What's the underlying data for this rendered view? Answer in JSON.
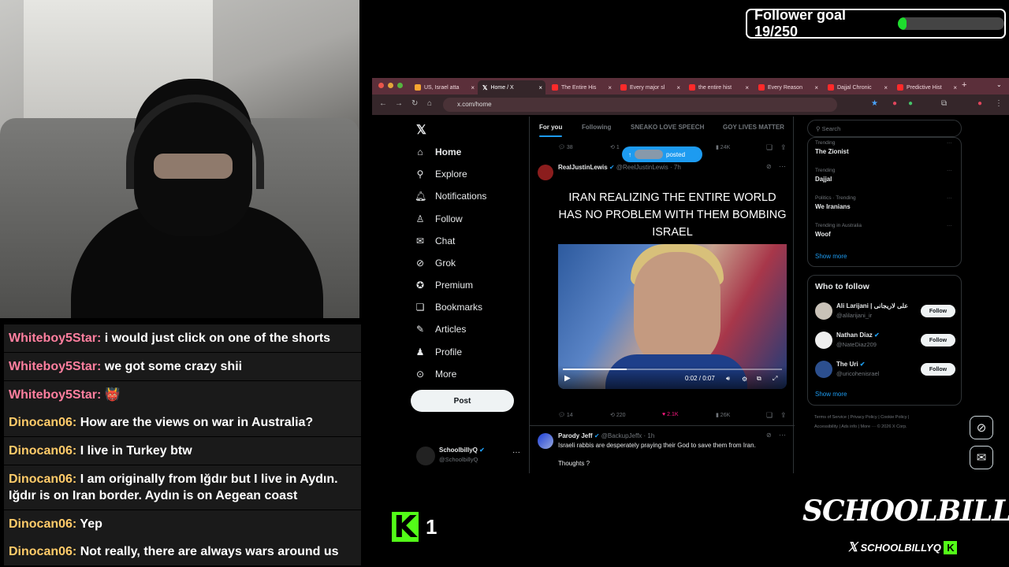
{
  "overlay": {
    "follower_goal": {
      "label": "Follower goal 19/250",
      "current": 19,
      "target": 250,
      "fill_fraction": 0.076,
      "color": "#1edc2e"
    },
    "kick_viewers": "1",
    "brand_name": "SCHOOLBILLYQ",
    "brand_handle": "SCHOOLBILLYQ"
  },
  "chat": [
    {
      "user": "Whiteboy5Star:",
      "message": "i would just click on one of the shorts",
      "color": "pink"
    },
    {
      "user": "Whiteboy5Star:",
      "message": "we got some crazy shii",
      "color": "pink"
    },
    {
      "user": "Whiteboy5Star:",
      "message": "👹",
      "color": "pink"
    },
    {
      "user": "Dinocan06:",
      "message": "How are the views on war in Australia?",
      "color": "yellow"
    },
    {
      "user": "Dinocan06:",
      "message": "I live in Turkey btw",
      "color": "yellow"
    },
    {
      "user": "Dinocan06:",
      "message": "I am originally from Iğdır but I live in Aydın. Iğdır is on Iran border. Aydın is on Aegean coast",
      "color": "yellow"
    },
    {
      "user": "Dinocan06:",
      "message": "Yep",
      "color": "yellow"
    },
    {
      "user": "Dinocan06:",
      "message": "Not really, there are always wars around us",
      "color": "yellow"
    }
  ],
  "browser": {
    "tabs": [
      {
        "title": "US, Israel atta",
        "active": false
      },
      {
        "title": "Home / X",
        "active": true
      },
      {
        "title": "The Entire His",
        "active": false
      },
      {
        "title": "Every major sl",
        "active": false
      },
      {
        "title": "the entire hist",
        "active": false
      },
      {
        "title": "Every Reason",
        "active": false
      },
      {
        "title": "Dajjal Chronic",
        "active": false
      },
      {
        "title": "Predictive Hist",
        "active": false
      }
    ],
    "url": "x.com/home"
  },
  "x": {
    "nav": [
      "Home",
      "Explore",
      "Notifications",
      "Follow",
      "Chat",
      "Grok",
      "Premium",
      "Bookmarks",
      "Articles",
      "Profile",
      "More"
    ],
    "post_button": "Post",
    "account": {
      "name": "SchoolbillyQ",
      "handle": "@SchoolbillyQ"
    },
    "feed_tabs": [
      "For you",
      "Following",
      "SNEAKO LOVE SPEECH",
      "GOY LIVES MATTER"
    ],
    "top_stats": {
      "replies": "38",
      "retweets": "1",
      "views": "24K"
    },
    "posted_pill": "posted",
    "tweet": {
      "author": "RealJustinLewis",
      "handle": "@ReelJustinLewis · 7h",
      "caption": "IRAN REALIZING THE ENTIRE WORLD HAS NO PROBLEM WITH THEM BOMBING ISRAEL",
      "video_time": "0:02 / 0:07",
      "video_progress": 0.29,
      "replies": "14",
      "retweets": "220",
      "likes": "2.1K",
      "views": "26K"
    },
    "tweet2": {
      "author": "Parody Jeff",
      "handle": "@BackupJeffx · 1h",
      "text": "Israeli rabbis are desperately praying their God to save them from Iran.",
      "text2": "Thoughts ?"
    },
    "search_placeholder": "Search",
    "trends": [
      {
        "context": "Trending",
        "name": "The Zionist"
      },
      {
        "context": "Trending",
        "name": "Dajjal"
      },
      {
        "context": "Politics · Trending",
        "name": "We Iranians"
      },
      {
        "context": "Trending in Australia",
        "name": "Woof"
      }
    ],
    "show_more": "Show more",
    "who_to_follow": "Who to follow",
    "suggestions": [
      {
        "name": "Ali Larijani | علی لاریجانی",
        "handle": "@alilarijani_ir",
        "button": "Follow"
      },
      {
        "name": "Nathan Diaz",
        "handle": "@NateDiaz209",
        "button": "Follow"
      },
      {
        "name": "The Uri",
        "handle": "@uricohenisrael",
        "button": "Follow"
      }
    ],
    "footer_line1": "Terms of Service  |  Privacy Policy  |  Cookie Policy  |",
    "footer_line2": "Accessibility  |  Ads info  |  More ···  © 2026 X Corp."
  }
}
